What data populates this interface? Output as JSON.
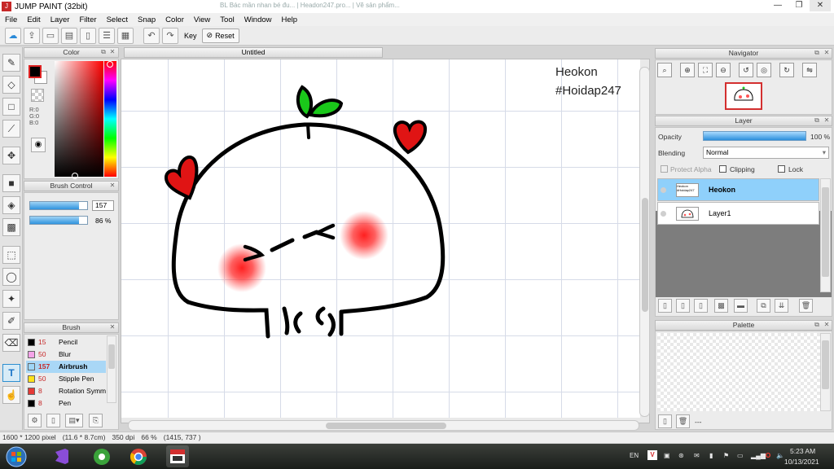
{
  "window": {
    "title": "JUMP PAINT (32bit)",
    "ghost_tabs": "BL Bác mần nhan bé đu... | Headon247.pro... | Vẽ sản phẩm...",
    "controls": [
      "—",
      "❐",
      "✕"
    ]
  },
  "menu": [
    "File",
    "Edit",
    "Layer",
    "Filter",
    "Select",
    "Snap",
    "Color",
    "View",
    "Tool",
    "Window",
    "Help"
  ],
  "toolbar": {
    "key_label": "Key",
    "reset_label": "Reset"
  },
  "color_panel": {
    "title": "Color",
    "r": "R:0",
    "g": "G:0",
    "b": "B:0",
    "fg_color": "#000000",
    "bg_color": "#ffffff"
  },
  "brush_control": {
    "title": "Brush Control",
    "size_value": "157",
    "size_fraction": 0.85,
    "opacity_value": "86 %",
    "opacity_fraction": 0.86
  },
  "brush_list": {
    "title": "Brush",
    "items": [
      {
        "size": "15",
        "name": "Pencil",
        "color": "#000000",
        "selected": false
      },
      {
        "size": "50",
        "name": "Blur",
        "color": "#f5a3e8",
        "selected": false
      },
      {
        "size": "157",
        "name": "Airbrush",
        "color": "#9fd6f7",
        "selected": true
      },
      {
        "size": "50",
        "name": "Stipple Pen",
        "color": "#ffe21a",
        "selected": false
      },
      {
        "size": "8",
        "name": "Rotation Symm",
        "color": "#e53935",
        "selected": false
      },
      {
        "size": "8",
        "name": "Pen",
        "color": "#000000",
        "selected": false
      }
    ]
  },
  "canvas": {
    "tab_title": "Untitled",
    "text_line1": "Heokon",
    "text_line2": "#Hoidap247"
  },
  "navigator": {
    "title": "Navigator"
  },
  "layer_panel": {
    "title": "Layer",
    "opacity_label": "Opacity",
    "opacity_value": "100 %",
    "opacity_fraction": 1.0,
    "blending_label": "Blending",
    "blending_value": "Normal",
    "protect_alpha": "Protect Alpha",
    "clipping": "Clipping",
    "lock": "Lock",
    "layers": [
      {
        "name": "Heokon",
        "thumb_text": "Heokon #Hoidap247",
        "selected": true
      },
      {
        "name": "Layer1",
        "thumb_text": "",
        "selected": false
      }
    ]
  },
  "palette": {
    "title": "Palette",
    "footer": "---"
  },
  "status": {
    "size": "1600 * 1200 pixel",
    "cm": "(11.6 * 8.7cm)",
    "dpi": "350 dpi",
    "zoom": "66 %",
    "coords": "(1415, 737 )"
  },
  "taskbar": {
    "lang": "EN",
    "time": "5:23 AM",
    "date": "10/13/2021"
  }
}
